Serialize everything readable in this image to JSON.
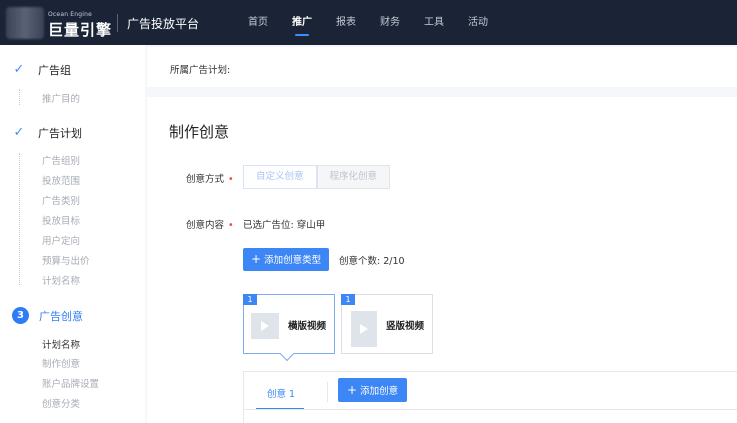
{
  "header": {
    "logo_small": "Ocean Engine",
    "logo_main": "巨量引擎",
    "platform": "广告投放平台",
    "nav": [
      "首页",
      "推广",
      "报表",
      "财务",
      "工具",
      "活动"
    ],
    "active_nav": "推广"
  },
  "sidebar": {
    "step1": {
      "title": "广告组",
      "subs": [
        "推广目的"
      ]
    },
    "step2": {
      "title": "广告计划",
      "subs": [
        "广告组别",
        "投放范围",
        "广告类别",
        "投放目标",
        "用户定向",
        "预算与出价",
        "计划名称"
      ]
    },
    "step3": {
      "num": "3",
      "title": "广告创意",
      "subs": [
        "计划名称",
        "制作创意",
        "账户品牌设置",
        "创意分类"
      ]
    }
  },
  "plan_bar": {
    "label": "所属广告计划:"
  },
  "main": {
    "title": "制作创意",
    "mode_label": "创意方式",
    "mode_options": [
      "自定义创意",
      "程序化创意"
    ],
    "content_label": "创意内容",
    "selected_position": "已选广告位: 穿山甲",
    "add_type_button": "添加创意类型",
    "count_text": "创意个数: 2/10",
    "cards": [
      {
        "badge": "1",
        "label": "横版视频"
      },
      {
        "badge": "1",
        "label": "竖版视频"
      }
    ],
    "tab_label": "创意 1",
    "add_creative_button": "添加创意"
  },
  "colors": {
    "accent": "#3d86f5",
    "topbar": "#1b2437",
    "required": "#e8494a"
  }
}
